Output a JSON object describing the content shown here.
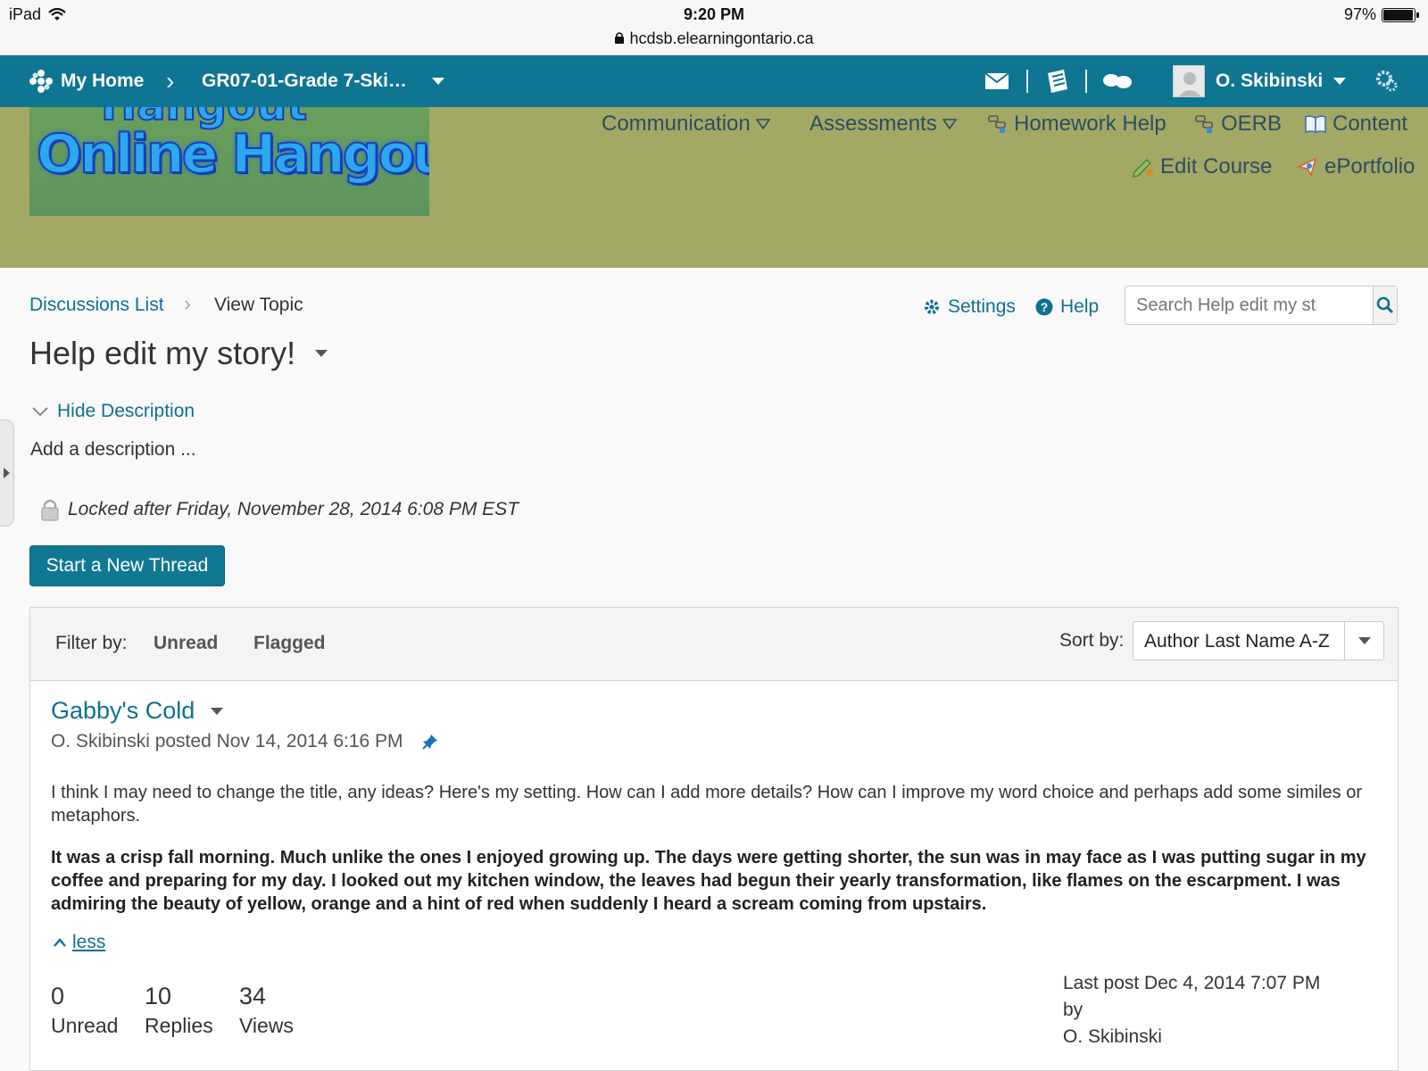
{
  "status_bar": {
    "device": "iPad",
    "time": "9:20 PM",
    "url": "hcdsb.elearningontario.ca",
    "battery": "97%",
    "battery_level": 0.97
  },
  "navbar": {
    "home": "My Home",
    "course": "GR07-01-Grade 7-Ski…",
    "user": "O. Skibinski",
    "icons": [
      "message-icon",
      "assignments-icon",
      "discussion-icon",
      "settings-icon"
    ]
  },
  "banner": {
    "logo_text_top": "Hangout",
    "logo_text": "Online Hangout",
    "links": {
      "communication": "Communication",
      "assessments": "Assessments",
      "homework_help": "Homework Help",
      "oerb": "OERB",
      "content": "Content",
      "edit_course": "Edit Course",
      "eportfolio": "ePortfolio"
    },
    "colors": {
      "banner_bg": "#a3a865",
      "navbar_bg": "#0e7593"
    }
  },
  "breadcrumb": {
    "discussions_list": "Discussions List",
    "current": "View Topic"
  },
  "toolbar": {
    "settings": "Settings",
    "help": "Help",
    "search_placeholder": "Search Help edit my st"
  },
  "topic": {
    "title": "Help edit my story!",
    "hide_description": "Hide Description",
    "description": "Add a description ...",
    "locked": "Locked after Friday, November 28, 2014 6:08 PM EST",
    "new_thread_button": "Start a New Thread"
  },
  "filter": {
    "label": "Filter by:",
    "unread": "Unread",
    "flagged": "Flagged",
    "sort_label": "Sort by:",
    "sort_value": "Author Last Name A-Z"
  },
  "thread": {
    "title": "Gabby's Cold",
    "meta": "O. Skibinski posted Nov 14, 2014 6:16 PM",
    "body": "I think I may need to change the title, any ideas? Here's my setting. How can I add more details? How can I improve my word choice and perhaps add some similes or metaphors.",
    "body_bold": "It was a crisp fall morning. Much unlike the ones I enjoyed growing up. The days were getting shorter, the sun was in may face as I was putting sugar in my coffee and preparing for my day. I looked out my kitchen window, the leaves had begun their yearly transformation, like flames on the escarpment. I was admiring the beauty of yellow, orange and a hint of red when suddenly I heard a scream coming from upstairs.",
    "less": "less",
    "stats": {
      "unread_count": "0",
      "unread_label": "Unread",
      "replies_count": "10",
      "replies_label": "Replies",
      "views_count": "34",
      "views_label": "Views"
    },
    "last_post": "Last post Dec 4, 2014 7:07 PM",
    "last_post_by": "by",
    "last_post_author": "O. Skibinski"
  }
}
